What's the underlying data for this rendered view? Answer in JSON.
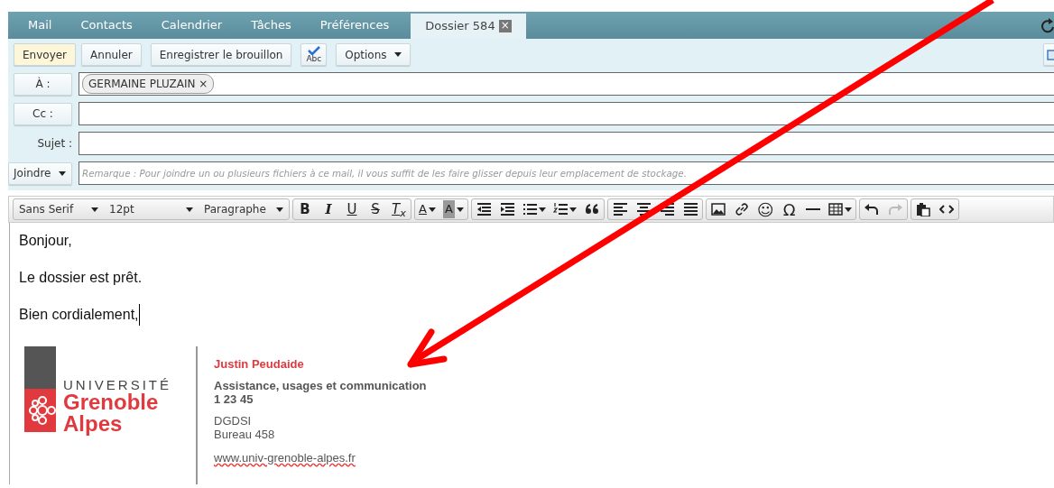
{
  "tabs": [
    {
      "label": "Mail",
      "selected": false,
      "closable": false
    },
    {
      "label": "Contacts",
      "selected": false,
      "closable": false
    },
    {
      "label": "Calendrier",
      "selected": false,
      "closable": false
    },
    {
      "label": "Tâches",
      "selected": false,
      "closable": false
    },
    {
      "label": "Préférences",
      "selected": false,
      "closable": false
    },
    {
      "label": "Dossier 584",
      "selected": true,
      "closable": true,
      "close": "×"
    }
  ],
  "actions": [
    {
      "kind": "primary",
      "label": "Envoyer"
    },
    {
      "kind": "plain",
      "label": "Annuler"
    },
    {
      "kind": "plain",
      "label": "Enregistrer le brouillon"
    },
    {
      "kind": "spellcheck",
      "label": "Abc"
    },
    {
      "kind": "dropdown",
      "label": "Options"
    }
  ],
  "headers": {
    "to": {
      "label": "À :",
      "recipients": [
        {
          "name": "GERMAINE PLUZAIN",
          "remove": "×"
        }
      ]
    },
    "cc": {
      "label": "Cc :"
    },
    "subject": {
      "label": "Sujet :"
    },
    "attach": {
      "label": "Joindre",
      "placeholder": "Remarque : Pour joindre un ou plusieurs fichiers à ce mail, il vous suffit de les faire glisser depuis leur emplacement de stockage."
    }
  },
  "editor": {
    "selects": [
      {
        "kind": "font",
        "label": "Sans Serif"
      },
      {
        "kind": "size",
        "label": "12pt"
      },
      {
        "kind": "format",
        "label": "Paragraphe"
      }
    ],
    "groups": [
      [
        {
          "kind": "bold",
          "label": "B"
        },
        {
          "kind": "italic",
          "label": "I"
        },
        {
          "kind": "underline",
          "label": "U"
        },
        {
          "kind": "strike",
          "label": "S"
        },
        {
          "kind": "clear",
          "label": "T$_{x}$"
        }
      ],
      [
        {
          "kind": "text-color",
          "label": "A"
        },
        {
          "kind": "back-color",
          "label": "A"
        }
      ],
      [
        {
          "kind": "outdent"
        },
        {
          "kind": "indent"
        },
        {
          "kind": "bullets"
        },
        {
          "kind": "numbers"
        },
        {
          "kind": "quote"
        }
      ],
      [
        {
          "kind": "align-left"
        },
        {
          "kind": "align-center"
        },
        {
          "kind": "align-right"
        },
        {
          "kind": "justify"
        }
      ],
      [
        {
          "kind": "image"
        },
        {
          "kind": "link"
        },
        {
          "kind": "emoji",
          "label": "☺"
        },
        {
          "kind": "omega",
          "label": "Ω"
        },
        {
          "kind": "hr"
        },
        {
          "kind": "table"
        }
      ],
      [
        {
          "kind": "undo",
          "disabled": false
        },
        {
          "kind": "redo",
          "disabled": true
        }
      ],
      [
        {
          "kind": "paste"
        },
        {
          "kind": "code"
        }
      ]
    ]
  },
  "body": {
    "paragraphs": [
      "Bonjour,",
      "Le dossier est prêt.",
      "Bien cordialement,"
    ]
  },
  "signature": {
    "logo": {
      "line1": "UNIVERSITÉ",
      "line2": "Grenoble",
      "line3": "Alpes"
    },
    "name": "Justin Peudaide",
    "role": "Assistance, usages et communication",
    "phone": "1 23 45",
    "lines": [
      "DGDSI",
      "Bureau 458"
    ],
    "website": "www.univ-grenoble-alpes.fr"
  },
  "annotations": [
    {
      "kind": "arrow"
    }
  ]
}
